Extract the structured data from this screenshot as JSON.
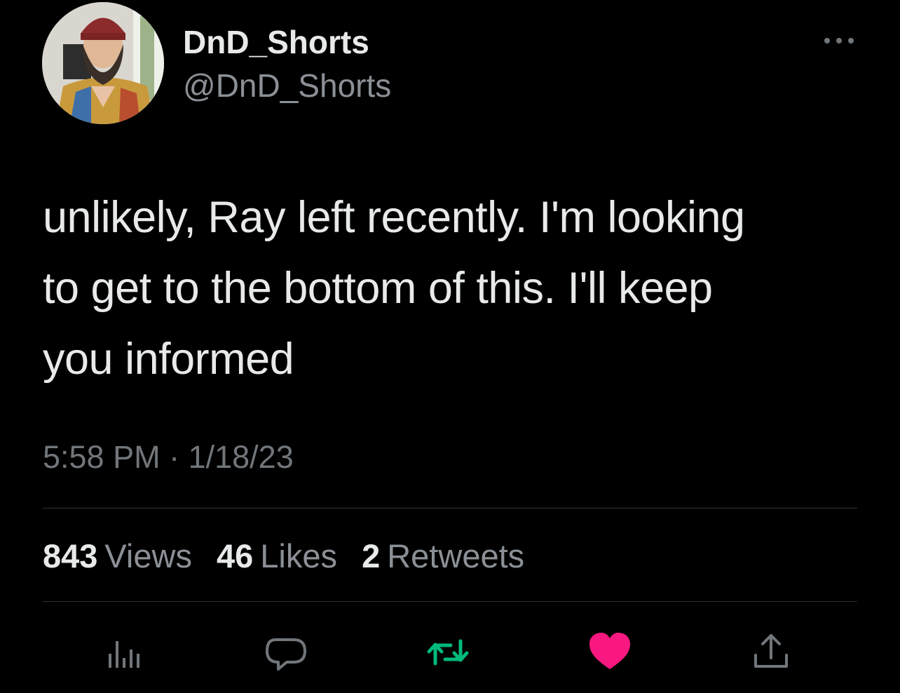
{
  "author": {
    "display_name": "DnD_Shorts",
    "handle": "@DnD_Shorts",
    "avatar_icon": "profile-photo-bearded-man"
  },
  "tweet": {
    "lines": [
      "unlikely, Ray left recently. I'm looking",
      "to get to the bottom of this. I'll keep",
      "you informed"
    ],
    "timestamp": "5:58 PM · 1/18/23"
  },
  "stats": {
    "views_count": "843",
    "views_label": "Views",
    "likes_count": "46",
    "likes_label": "Likes",
    "retweets_count": "2",
    "retweets_label": "Retweets"
  },
  "actions": [
    {
      "icon": "analytics-icon"
    },
    {
      "icon": "reply-icon"
    },
    {
      "icon": "retweet-icon",
      "color": "#00ba7c"
    },
    {
      "icon": "like-icon",
      "color": "#f91880"
    },
    {
      "icon": "share-icon"
    }
  ],
  "colors": {
    "background": "#000000",
    "primary_text": "#e7e9ea",
    "secondary_text": "#71767b",
    "retweeted": "#00ba7c",
    "liked": "#f91880"
  }
}
